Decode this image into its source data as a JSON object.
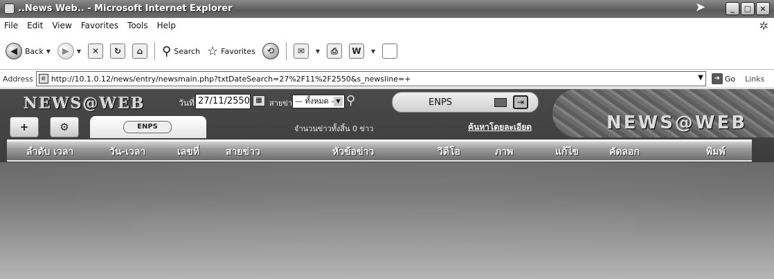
{
  "window": {
    "title": "..News Web.. - Microsoft Internet Explorer",
    "buttons": [
      "_",
      "□",
      "×"
    ]
  },
  "menu": [
    "File",
    "Edit",
    "View",
    "Favorites",
    "Tools",
    "Help"
  ],
  "toolbar": {
    "back_label": "Back",
    "search_label": "Search",
    "favorites_label": "Favorites"
  },
  "address": {
    "label": "Address",
    "url": "http://10.1.0.12/news/entry/newsmain.php?txtDateSearch=27%2F11%2F2550&s_newsline=+",
    "go_label": "Go",
    "links_label": "Links"
  },
  "page": {
    "logo_text": "NEWS@WEB",
    "brand_text": "NEWS@WEB",
    "date_label": "วันที่",
    "date_value": "27/11/2550",
    "line_label": "สายข่าว",
    "line_value": "— ทั้งหมด —",
    "user_name": "ENPS",
    "tab_label": "ENPS",
    "total_text": "จำนวนข่าวทั้งสิ้น 0 ข่าว",
    "advanced_search": "ค้นหาโดยละเอียด",
    "columns": [
      "ลำดับ เวลา",
      "วัน-เวลา",
      "เลขที่",
      "สายข่าว",
      "หัวข้อข่าว",
      "วิดีโอ",
      "ภาพ",
      "แก้ไข",
      "คัดลอก",
      "พิมพ์"
    ]
  }
}
